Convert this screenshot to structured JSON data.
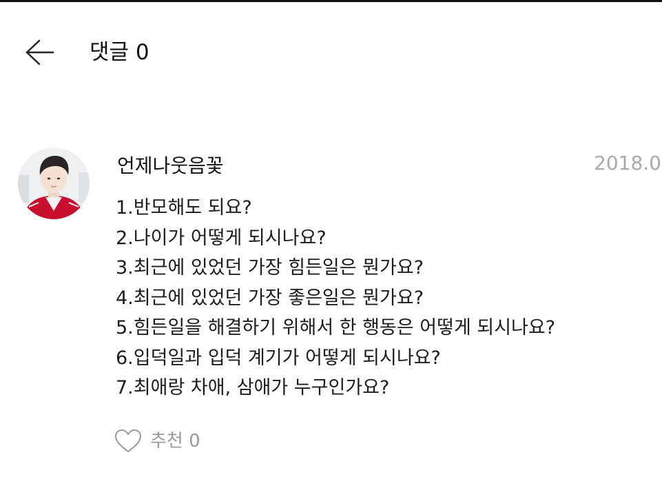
{
  "header": {
    "title": "댓글 0"
  },
  "comment": {
    "author": "언제나웃음꽃",
    "timestamp": "2018.0",
    "lines": [
      "1.반모해도 되요?",
      "2.나이가 어떻게 되시나요?",
      "3.최근에 있었던 가장 힘든일은 뭔가요?",
      "4.최근에 있었던 가장 좋은일은 뭔가요?",
      "5.힘든일을 해결하기 위해서 한 행동은 어떻게 되시나요?",
      "6.입덕일과 입덕 계기가 어떻게 되시나요?",
      "7.최애랑 차애, 삼애가 누구인가요?"
    ],
    "like_label": "추천 0"
  },
  "colors": {
    "text": "#1c1c1c",
    "muted": "#a9a9a9",
    "jacket_red": "#c8102e",
    "background": "#ffffff"
  },
  "icons": {
    "back": "arrow-left-icon",
    "like": "heart-outline-icon"
  }
}
